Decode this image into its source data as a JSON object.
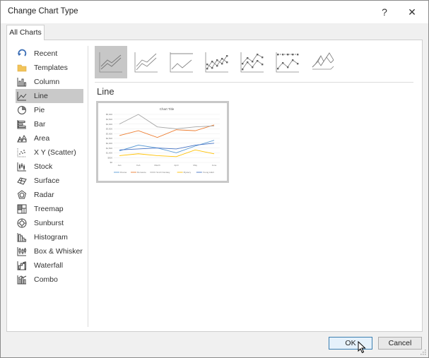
{
  "dialog": {
    "title": "Change Chart Type",
    "help_label": "?",
    "close_label": "✕"
  },
  "tabs": [
    {
      "label": "All Charts"
    }
  ],
  "sidebar": {
    "items": [
      {
        "label": "Recent",
        "icon": "recent-icon"
      },
      {
        "label": "Templates",
        "icon": "folder-icon"
      },
      {
        "label": "Column",
        "icon": "column-chart-icon"
      },
      {
        "label": "Line",
        "icon": "line-chart-icon",
        "selected": true
      },
      {
        "label": "Pie",
        "icon": "pie-chart-icon"
      },
      {
        "label": "Bar",
        "icon": "bar-chart-icon"
      },
      {
        "label": "Area",
        "icon": "area-chart-icon"
      },
      {
        "label": "X Y (Scatter)",
        "icon": "scatter-chart-icon"
      },
      {
        "label": "Stock",
        "icon": "stock-chart-icon"
      },
      {
        "label": "Surface",
        "icon": "surface-chart-icon"
      },
      {
        "label": "Radar",
        "icon": "radar-chart-icon"
      },
      {
        "label": "Treemap",
        "icon": "treemap-chart-icon"
      },
      {
        "label": "Sunburst",
        "icon": "sunburst-chart-icon"
      },
      {
        "label": "Histogram",
        "icon": "histogram-chart-icon"
      },
      {
        "label": "Box & Whisker",
        "icon": "box-whisker-chart-icon"
      },
      {
        "label": "Waterfall",
        "icon": "waterfall-chart-icon"
      },
      {
        "label": "Combo",
        "icon": "combo-chart-icon"
      }
    ]
  },
  "main": {
    "section_title": "Line",
    "subtypes": [
      {
        "icon": "line-icon",
        "selected": true
      },
      {
        "icon": "stacked-line-icon"
      },
      {
        "icon": "100-stacked-line-icon"
      },
      {
        "icon": "line-with-markers-icon"
      },
      {
        "icon": "stacked-line-with-markers-icon"
      },
      {
        "icon": "100-stacked-line-with-markers-icon"
      },
      {
        "icon": "3d-line-icon"
      }
    ]
  },
  "preview": {
    "chart_data": {
      "type": "line",
      "title": "Chart Title",
      "categories": [
        "Jan",
        "Feb",
        "March",
        "April",
        "May",
        "June"
      ],
      "y_ticks": [
        "$0",
        "$500",
        "$1,000",
        "$1,500",
        "$2,000",
        "$2,500",
        "$3,000",
        "$3,500",
        "$4,000",
        "$4,500",
        "$5,000"
      ],
      "ylim": [
        0,
        5000
      ],
      "series": [
        {
          "name": "Drama",
          "color": "#5b9bd5",
          "values": [
            1200,
            1800,
            1500,
            1000,
            1700,
            2300
          ]
        },
        {
          "name": "Romance",
          "color": "#ed7d31",
          "values": [
            2800,
            3300,
            2600,
            3400,
            3300,
            3900
          ]
        },
        {
          "name": "Sci-Fi Fantasy",
          "color": "#a5a5a5",
          "values": [
            4000,
            5000,
            3700,
            3500,
            3700,
            3800
          ]
        },
        {
          "name": "Mystery",
          "color": "#ffc000",
          "values": [
            700,
            900,
            700,
            600,
            1300,
            900
          ]
        },
        {
          "name": "Young Adult",
          "color": "#4472c4",
          "values": [
            1300,
            1400,
            1500,
            1400,
            1800,
            2000
          ]
        }
      ]
    }
  },
  "footer": {
    "ok_label": "OK",
    "cancel_label": "Cancel"
  }
}
